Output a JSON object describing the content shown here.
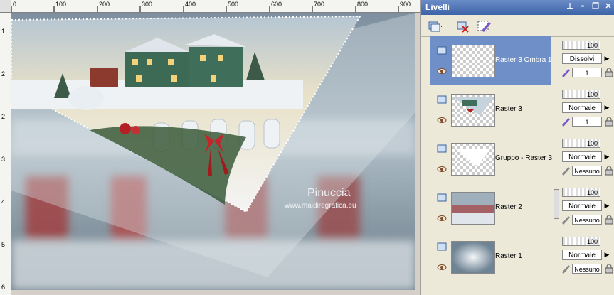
{
  "ruler": {
    "top_labels": [
      "0",
      "100",
      "200",
      "300",
      "400",
      "500",
      "600",
      "700",
      "800",
      "900"
    ],
    "left_labels": [
      "1",
      "2",
      "2",
      "3",
      "4",
      "5",
      "6"
    ]
  },
  "canvas": {
    "watermark_title": "Pinuccia",
    "watermark_url": "www.maidiregrafica.eu"
  },
  "panel": {
    "title": "Livelli",
    "title_buttons": [
      "pin-icon",
      "close-icon",
      "restore-icon",
      "close-x-icon"
    ]
  },
  "layers": [
    {
      "name": "Raster 3 Ombra 1",
      "selected": true,
      "opacity": "100",
      "blend": "Dissolvi",
      "sub": "1"
    },
    {
      "name": "Raster 3",
      "selected": false,
      "opacity": "100",
      "blend": "Normale",
      "sub": "1"
    },
    {
      "name": "Gruppo - Raster 3",
      "selected": false,
      "opacity": "100",
      "blend": "Normale",
      "sub": "Nessuno"
    },
    {
      "name": "Raster 2",
      "selected": false,
      "opacity": "100",
      "blend": "Normale",
      "sub": "Nessuno"
    },
    {
      "name": "Raster 1",
      "selected": false,
      "opacity": "100",
      "blend": "Normale",
      "sub": "Nessuno"
    }
  ],
  "colors": {
    "selection": "#6e8fc7",
    "panel_title": "#3d63a8"
  }
}
